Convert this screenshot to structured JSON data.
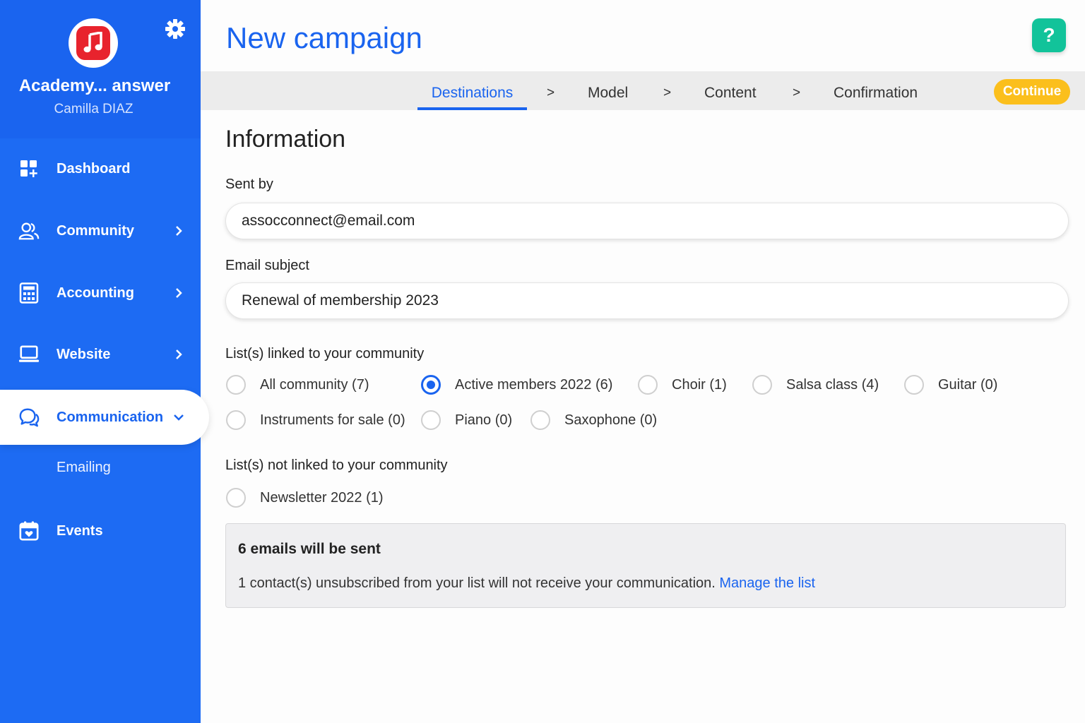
{
  "sidebar": {
    "org_name": "Academy... answer",
    "user_name": "Camilla DIAZ",
    "items": [
      {
        "label": "Dashboard"
      },
      {
        "label": "Community"
      },
      {
        "label": "Accounting"
      },
      {
        "label": "Website"
      },
      {
        "label": "Communication"
      },
      {
        "label": "Events"
      }
    ],
    "sub_items": [
      {
        "label": "Emailing"
      }
    ],
    "colors": {
      "background": "#1d6bf3",
      "active_text": "#1a64ef",
      "logo_tile": "#e8232d"
    }
  },
  "header": {
    "title": "New campaign",
    "help_label": "?"
  },
  "steps": {
    "items": [
      {
        "label": "Destinations"
      },
      {
        "label": "Model"
      },
      {
        "label": "Content"
      },
      {
        "label": "Confirmation"
      }
    ],
    "separator": ">",
    "active": "Destinations",
    "continue_label": "Continue"
  },
  "form": {
    "section_title": "Information",
    "sent_by": {
      "label": "Sent by",
      "value": "assocconnect@email.com"
    },
    "subject": {
      "label": "Email subject",
      "value": "Renewal of membership 2023"
    },
    "linked_lists": {
      "label": "List(s) linked to your community",
      "options": [
        {
          "label": "All community (7)",
          "checked": false
        },
        {
          "label": "Active members 2022 (6)",
          "checked": true
        },
        {
          "label": "Choir (1)",
          "checked": false
        },
        {
          "label": "Salsa class (4)",
          "checked": false
        },
        {
          "label": "Guitar (0)",
          "checked": false
        },
        {
          "label": "Instruments for sale (0)",
          "checked": false
        },
        {
          "label": "Piano (0)",
          "checked": false
        },
        {
          "label": "Saxophone (0)",
          "checked": false
        }
      ]
    },
    "unlinked_lists": {
      "label": "List(s) not linked to your community",
      "options": [
        {
          "label": "Newsletter 2022 (1)",
          "checked": false
        }
      ]
    }
  },
  "summary": {
    "title": "6 emails will be sent",
    "text": "1 contact(s) unsubscribed from your list will not receive your communication.",
    "link": "Manage the list"
  },
  "icons": [
    "music-note-icon",
    "gear-icon",
    "dashboard-icon",
    "community-icon",
    "calculator-icon",
    "monitor-icon",
    "chat-bubbles-icon",
    "calendar-icon",
    "chevron-right-icon",
    "chevron-down-icon"
  ]
}
